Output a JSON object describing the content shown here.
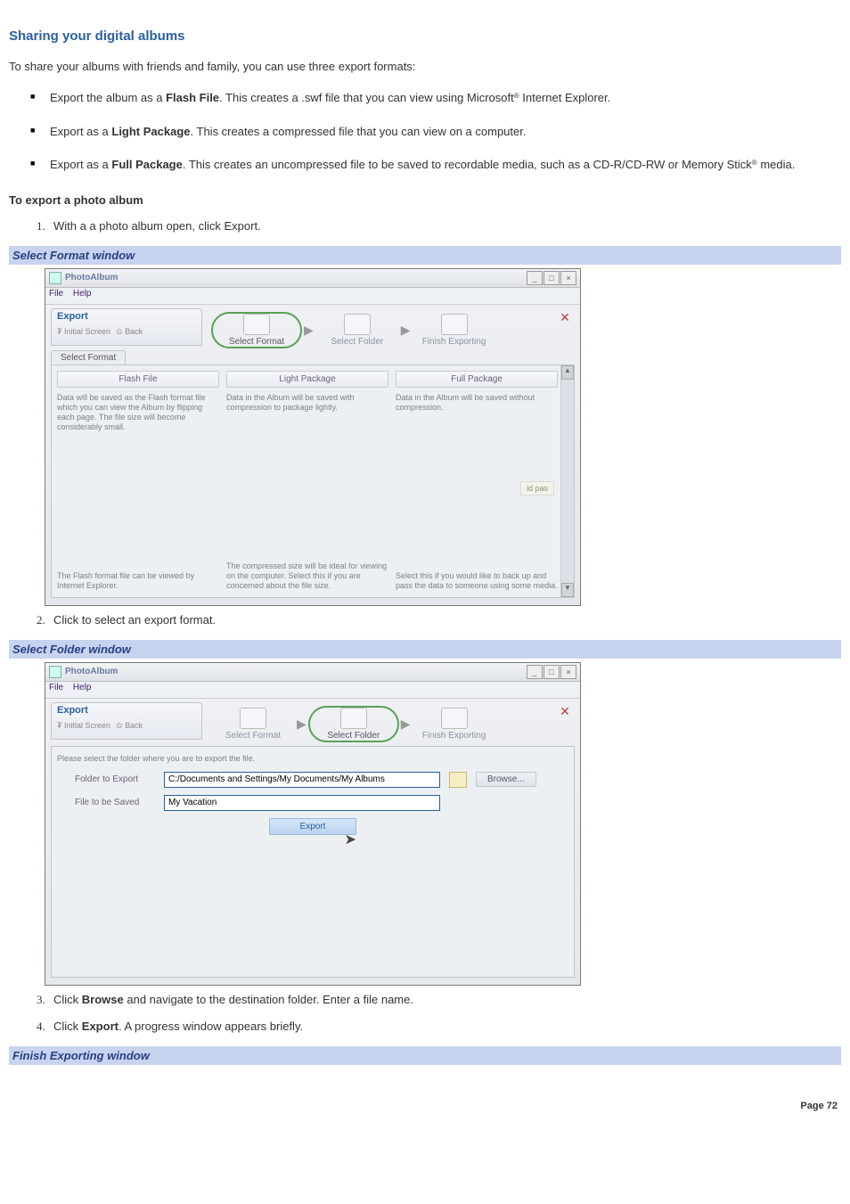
{
  "title": "Sharing your digital albums",
  "intro": "To share your albums with friends and family, you can use three export formats:",
  "bullets": {
    "b1_pre": "Export the album as a ",
    "b1_bold": "Flash File",
    "b1_post1": ". This creates a .swf file that you can view using Microsoft",
    "b1_reg": "®",
    "b1_post2": " Internet Explorer.",
    "b2_pre": "Export as a ",
    "b2_bold": "Light Package",
    "b2_post": ". This creates a compressed file that you can view on a computer.",
    "b3_pre": "Export as a ",
    "b3_bold": "Full Package",
    "b3_post1": ". This creates an uncompressed file to be saved to recordable media, such as a CD-R/CD-RW or Memory Stick",
    "b3_reg": "®",
    "b3_post2": " media."
  },
  "export_heading": "To export a photo album",
  "steps": {
    "s1": "With a a photo album open, click Export.",
    "s2": "Click to select an export format.",
    "s3_pre": "Click ",
    "s3_b1": "Browse",
    "s3_post": " and navigate to the destination folder. Enter a file name.",
    "s4_pre": "Click ",
    "s4_b1": "Export",
    "s4_post": ". A progress window appears briefly."
  },
  "captions": {
    "c1": "Select Format window",
    "c2": "Select Folder window",
    "c3": "Finish Exporting window"
  },
  "win": {
    "app_title": "PhotoAlbum",
    "menu_file": "File",
    "menu_help": "Help",
    "tab_export": "Export",
    "tab_initial": "Initial Screen",
    "tab_back": "Back",
    "wiz_select_format": "Select Format",
    "wiz_select_folder": "Select Folder",
    "wiz_finish": "Finish Exporting",
    "sub_select_format": "Select Format",
    "pkg": {
      "flash_title": "Flash File",
      "flash_desc": "Data will be saved as the Flash format file which you can view the Album by flipping each page. The file size will become considerably small.",
      "flash_hint": "The Flash format file can be viewed by Internet Explorer.",
      "light_title": "Light Package",
      "light_desc": "Data in the Album will be saved with compression to package lightly.",
      "light_hint": "The compressed size will be ideal for viewing on the computer. Select this if you are concerned about the file size.",
      "full_title": "Full Package",
      "full_desc": "Data in the Album will be saved without compression.",
      "full_hint": "Select this if you would like to back up and pass the data to someone using some media.",
      "pass_tag": "id pas"
    },
    "folder": {
      "instruction": "Please select the folder where you are to export the file.",
      "lbl_folder": "Folder to Export",
      "val_folder": "C:/Documents and Settings/My Documents/My Albums",
      "lbl_file": "File to be Saved",
      "val_file": "My Vacation",
      "browse": "Browse...",
      "export": "Export"
    }
  },
  "page_footer_label": "Page ",
  "page_footer_num": "72"
}
